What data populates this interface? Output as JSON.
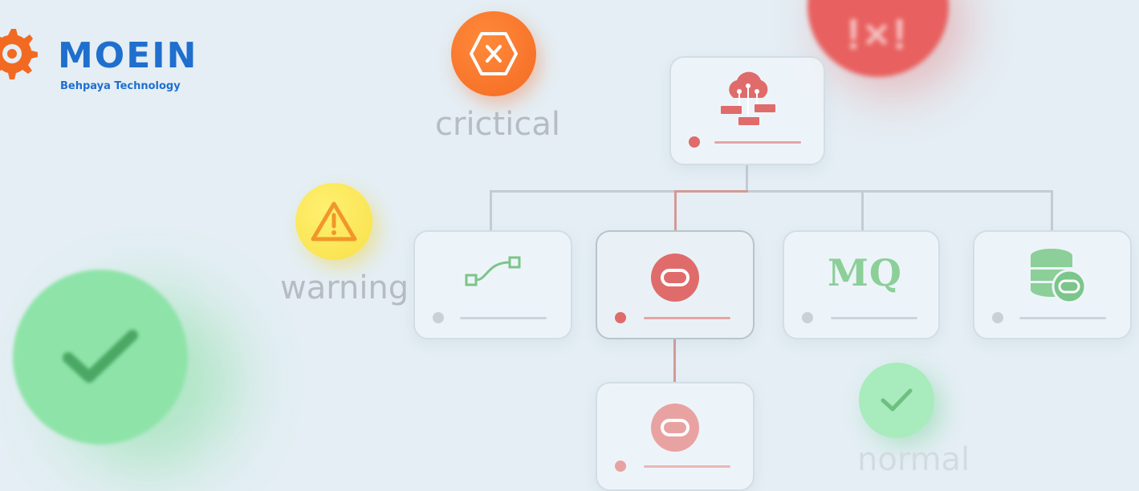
{
  "logo": {
    "title": "MOEIN",
    "subtitle": "Behpaya Technology",
    "color": "#1f6fce",
    "gear_color": "#f26a22"
  },
  "statuses": {
    "critical": {
      "label": "crictical",
      "icon": "x-hexagon-icon",
      "color": "#f46a24"
    },
    "warning": {
      "label": "warning",
      "icon": "warning-triangle-icon",
      "color": "#f8e04a"
    },
    "normal": {
      "label": "normal",
      "icon": "check-icon",
      "color": "#a8ebbd"
    }
  },
  "nodes": [
    {
      "id": "cloud",
      "icon": "cloud-network-icon",
      "state": "critical",
      "accent": "#e27777"
    },
    {
      "id": "flow",
      "icon": "flow-icon",
      "state": "normal",
      "accent": "#7cc48a"
    },
    {
      "id": "oracle",
      "icon": "oracle-icon",
      "state": "critical",
      "accent": "#e27777"
    },
    {
      "id": "mq",
      "icon": "mq-icon",
      "label": "MQ",
      "state": "normal",
      "accent": "#8ccf98"
    },
    {
      "id": "database",
      "icon": "database-icon",
      "state": "normal",
      "accent": "#8ccf98"
    },
    {
      "id": "oracle-child",
      "icon": "oracle-icon",
      "state": "critical",
      "accent": "#e9a2a2"
    }
  ]
}
